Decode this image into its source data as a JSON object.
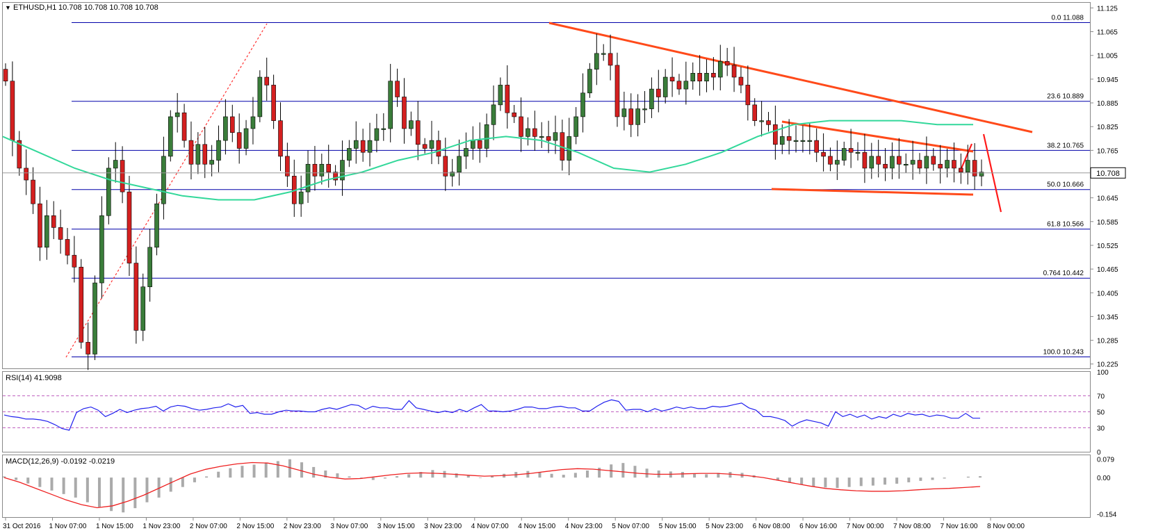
{
  "header": {
    "symbol": "ETHUSD,H1",
    "ohlc": "10.708 10.708 10.708 10.708"
  },
  "colors": {
    "up_candle": "#3a7d3a",
    "down_candle": "#d42020",
    "fib_line": "#0000aa",
    "ma_line": "#32d89a",
    "trend_line": "#ff4a1a",
    "rsi_line": "#2020ee",
    "macd_signal": "#ee2020",
    "macd_hist": "#aaaaaa",
    "level_dotted": "#c060c0"
  },
  "chart_data": [
    {
      "type": "candlestick",
      "title": "ETHUSD,H1",
      "price_axis_ticks": [
        "11.125",
        "11.065",
        "11.005",
        "10.945",
        "10.885",
        "10.825",
        "10.765",
        "10.705",
        "10.645",
        "10.585",
        "10.525",
        "10.465",
        "10.405",
        "10.345",
        "10.285",
        "10.225"
      ],
      "ylim": [
        10.214,
        11.138
      ],
      "current_price": "10.708",
      "time_axis_labels": [
        "31 Oct 2016",
        "1 Nov 07:00",
        "1 Nov 15:00",
        "1 Nov 23:00",
        "2 Nov 07:00",
        "2 Nov 15:00",
        "2 Nov 23:00",
        "3 Nov 07:00",
        "3 Nov 15:00",
        "3 Nov 23:00",
        "4 Nov 07:00",
        "4 Nov 15:00",
        "4 Nov 23:00",
        "5 Nov 07:00",
        "5 Nov 15:00",
        "5 Nov 23:00",
        "6 Nov 08:00",
        "6 Nov 16:00",
        "7 Nov 00:00",
        "7 Nov 08:00",
        "7 Nov 16:00",
        "8 Nov 00:00"
      ],
      "fibonacci_levels": [
        {
          "ratio": "0.0",
          "price": "11.088"
        },
        {
          "ratio": "23.6",
          "price": "10.889"
        },
        {
          "ratio": "38.2",
          "price": "10.765"
        },
        {
          "ratio": "50.0",
          "price": "10.666"
        },
        {
          "ratio": "61.8",
          "price": "10.566"
        },
        {
          "ratio": "0.764",
          "price": "10.442"
        },
        {
          "ratio": "100.0",
          "price": "10.243"
        }
      ],
      "candles_close": [
        10.94,
        10.79,
        10.72,
        10.69,
        10.63,
        10.52,
        10.6,
        10.57,
        10.54,
        10.5,
        10.47,
        10.28,
        10.25,
        10.43,
        10.6,
        10.72,
        10.74,
        10.66,
        10.48,
        10.31,
        10.42,
        10.52,
        10.63,
        10.75,
        10.85,
        10.86,
        10.79,
        10.73,
        10.78,
        10.73,
        10.74,
        10.79,
        10.85,
        10.81,
        10.77,
        10.82,
        10.85,
        10.95,
        10.93,
        10.84,
        10.75,
        10.7,
        10.63,
        10.66,
        10.73,
        10.7,
        10.73,
        10.71,
        10.69,
        10.74,
        10.77,
        10.79,
        10.76,
        10.79,
        10.82,
        10.82,
        10.94,
        10.9,
        10.82,
        10.84,
        10.78,
        10.77,
        10.79,
        10.75,
        10.7,
        10.71,
        10.75,
        10.77,
        10.79,
        10.77,
        10.83,
        10.88,
        10.93,
        10.86,
        10.85,
        10.8,
        10.82,
        10.8,
        10.8,
        10.79,
        10.81,
        10.74,
        10.8,
        10.85,
        10.91,
        10.97,
        11.01,
        11.01,
        10.98,
        10.85,
        10.87,
        10.83,
        10.87,
        10.87,
        10.92,
        10.9,
        10.95,
        10.94,
        10.92,
        10.94,
        10.96,
        10.94,
        10.96,
        10.95,
        10.99,
        10.98,
        10.95,
        10.93,
        10.88,
        10.84,
        10.84,
        10.83,
        10.78,
        10.8,
        10.79,
        10.79,
        10.79,
        10.79,
        10.76,
        10.75,
        10.73,
        10.74,
        10.77,
        10.76,
        10.76,
        10.72,
        10.75,
        10.73,
        10.72,
        10.75,
        10.73,
        10.73,
        10.74,
        10.72,
        10.75,
        10.73,
        10.72,
        10.74,
        10.72,
        10.71,
        10.74,
        10.7,
        10.71
      ],
      "series": [
        {
          "name": "",
          "type": "moving_average",
          "values": [
            10.8,
            10.76,
            10.72,
            10.69,
            10.67,
            10.65,
            10.64,
            10.64,
            10.66,
            10.69,
            10.71,
            10.74,
            10.76,
            10.79,
            10.8,
            10.79,
            10.76,
            10.72,
            10.71,
            10.73,
            10.76,
            10.8,
            10.83,
            10.84,
            10.84,
            10.84,
            10.83,
            10.83
          ]
        }
      ],
      "annotations": [
        "ascending dotted trend line",
        "descending channel",
        "falling broader trend line",
        "projected move arrow"
      ]
    },
    {
      "type": "line",
      "title": "RSI(14) 41.9098",
      "levels": [
        "100",
        "70",
        "50",
        "30",
        "0"
      ],
      "ylim": [
        0,
        100
      ],
      "values": [
        46,
        44,
        43,
        41,
        41,
        40,
        38,
        34,
        29,
        27,
        49,
        54,
        56,
        52,
        44,
        48,
        53,
        49,
        52,
        54,
        55,
        57,
        51,
        56,
        58,
        57,
        54,
        52,
        53,
        55,
        56,
        60,
        56,
        58,
        48,
        49,
        47,
        47,
        50,
        52,
        51,
        51,
        50,
        50,
        53,
        55,
        53,
        56,
        59,
        58,
        53,
        57,
        55,
        55,
        53,
        53,
        64,
        55,
        53,
        51,
        49,
        51,
        49,
        53,
        50,
        55,
        59,
        51,
        51,
        50,
        51,
        53,
        56,
        56,
        54,
        54,
        56,
        57,
        55,
        55,
        51,
        51,
        57,
        62,
        65,
        63,
        52,
        53,
        53,
        50,
        54,
        51,
        53,
        56,
        54,
        56,
        54,
        54,
        57,
        56,
        57,
        59,
        61,
        55,
        52,
        44,
        44,
        42,
        39,
        32,
        37,
        40,
        38,
        36,
        32,
        50,
        44,
        47,
        43,
        46,
        41,
        44,
        42,
        47,
        44,
        48,
        46,
        47,
        44,
        46,
        45,
        42,
        42,
        48,
        42,
        42
      ]
    },
    {
      "type": "bar",
      "title": "MACD(12,26,9) -0.0192 -0.0219",
      "axis_ticks": [
        "0.079",
        "0.00",
        "-0.154"
      ],
      "ylim": [
        -0.168,
        0.095
      ],
      "series": [
        {
          "name": "",
          "type": "histogram",
          "values": [
            0.005,
            -0.01,
            -0.025,
            -0.04,
            -0.055,
            -0.07,
            -0.085,
            -0.105,
            -0.125,
            -0.142,
            -0.148,
            -0.13,
            -0.105,
            -0.085,
            -0.06,
            -0.04,
            -0.02,
            0.005,
            0.025,
            0.04,
            0.05,
            0.055,
            0.062,
            0.07,
            0.078,
            0.065,
            0.045,
            0.03,
            0.018,
            0.005,
            -0.005,
            -0.01,
            -0.004,
            0.006,
            0.014,
            0.024,
            0.032,
            0.028,
            0.018,
            0.008,
            -0.002,
            0.008,
            0.016,
            0.024,
            0.028,
            0.022,
            0.016,
            0.012,
            0.02,
            0.03,
            0.042,
            0.056,
            0.062,
            0.05,
            0.038,
            0.03,
            0.026,
            0.024,
            0.018,
            0.014,
            0.02,
            0.024,
            0.02,
            0.01,
            0.0,
            -0.012,
            -0.022,
            -0.03,
            -0.038,
            -0.042,
            -0.044,
            -0.04,
            -0.036,
            -0.034,
            -0.03,
            -0.026,
            -0.02,
            -0.014,
            -0.01,
            -0.004,
            0.0,
            0.004,
            0.006
          ]
        },
        {
          "name": "",
          "type": "signal_line",
          "values": [
            0.0,
            -0.02,
            -0.045,
            -0.07,
            -0.095,
            -0.115,
            -0.128,
            -0.12,
            -0.1,
            -0.075,
            -0.045,
            -0.015,
            0.015,
            0.035,
            0.048,
            0.058,
            0.064,
            0.062,
            0.05,
            0.032,
            0.014,
            0.002,
            -0.006,
            -0.004,
            0.004,
            0.012,
            0.018,
            0.02,
            0.018,
            0.014,
            0.01,
            0.006,
            0.008,
            0.012,
            0.018,
            0.026,
            0.034,
            0.038,
            0.036,
            0.03,
            0.024,
            0.018,
            0.014,
            0.014,
            0.016,
            0.018,
            0.018,
            0.014,
            0.008,
            0.0,
            -0.012,
            -0.024,
            -0.036,
            -0.046,
            -0.052,
            -0.056,
            -0.058,
            -0.058,
            -0.056,
            -0.052,
            -0.048,
            -0.046,
            -0.042,
            -0.038
          ]
        }
      ]
    }
  ]
}
